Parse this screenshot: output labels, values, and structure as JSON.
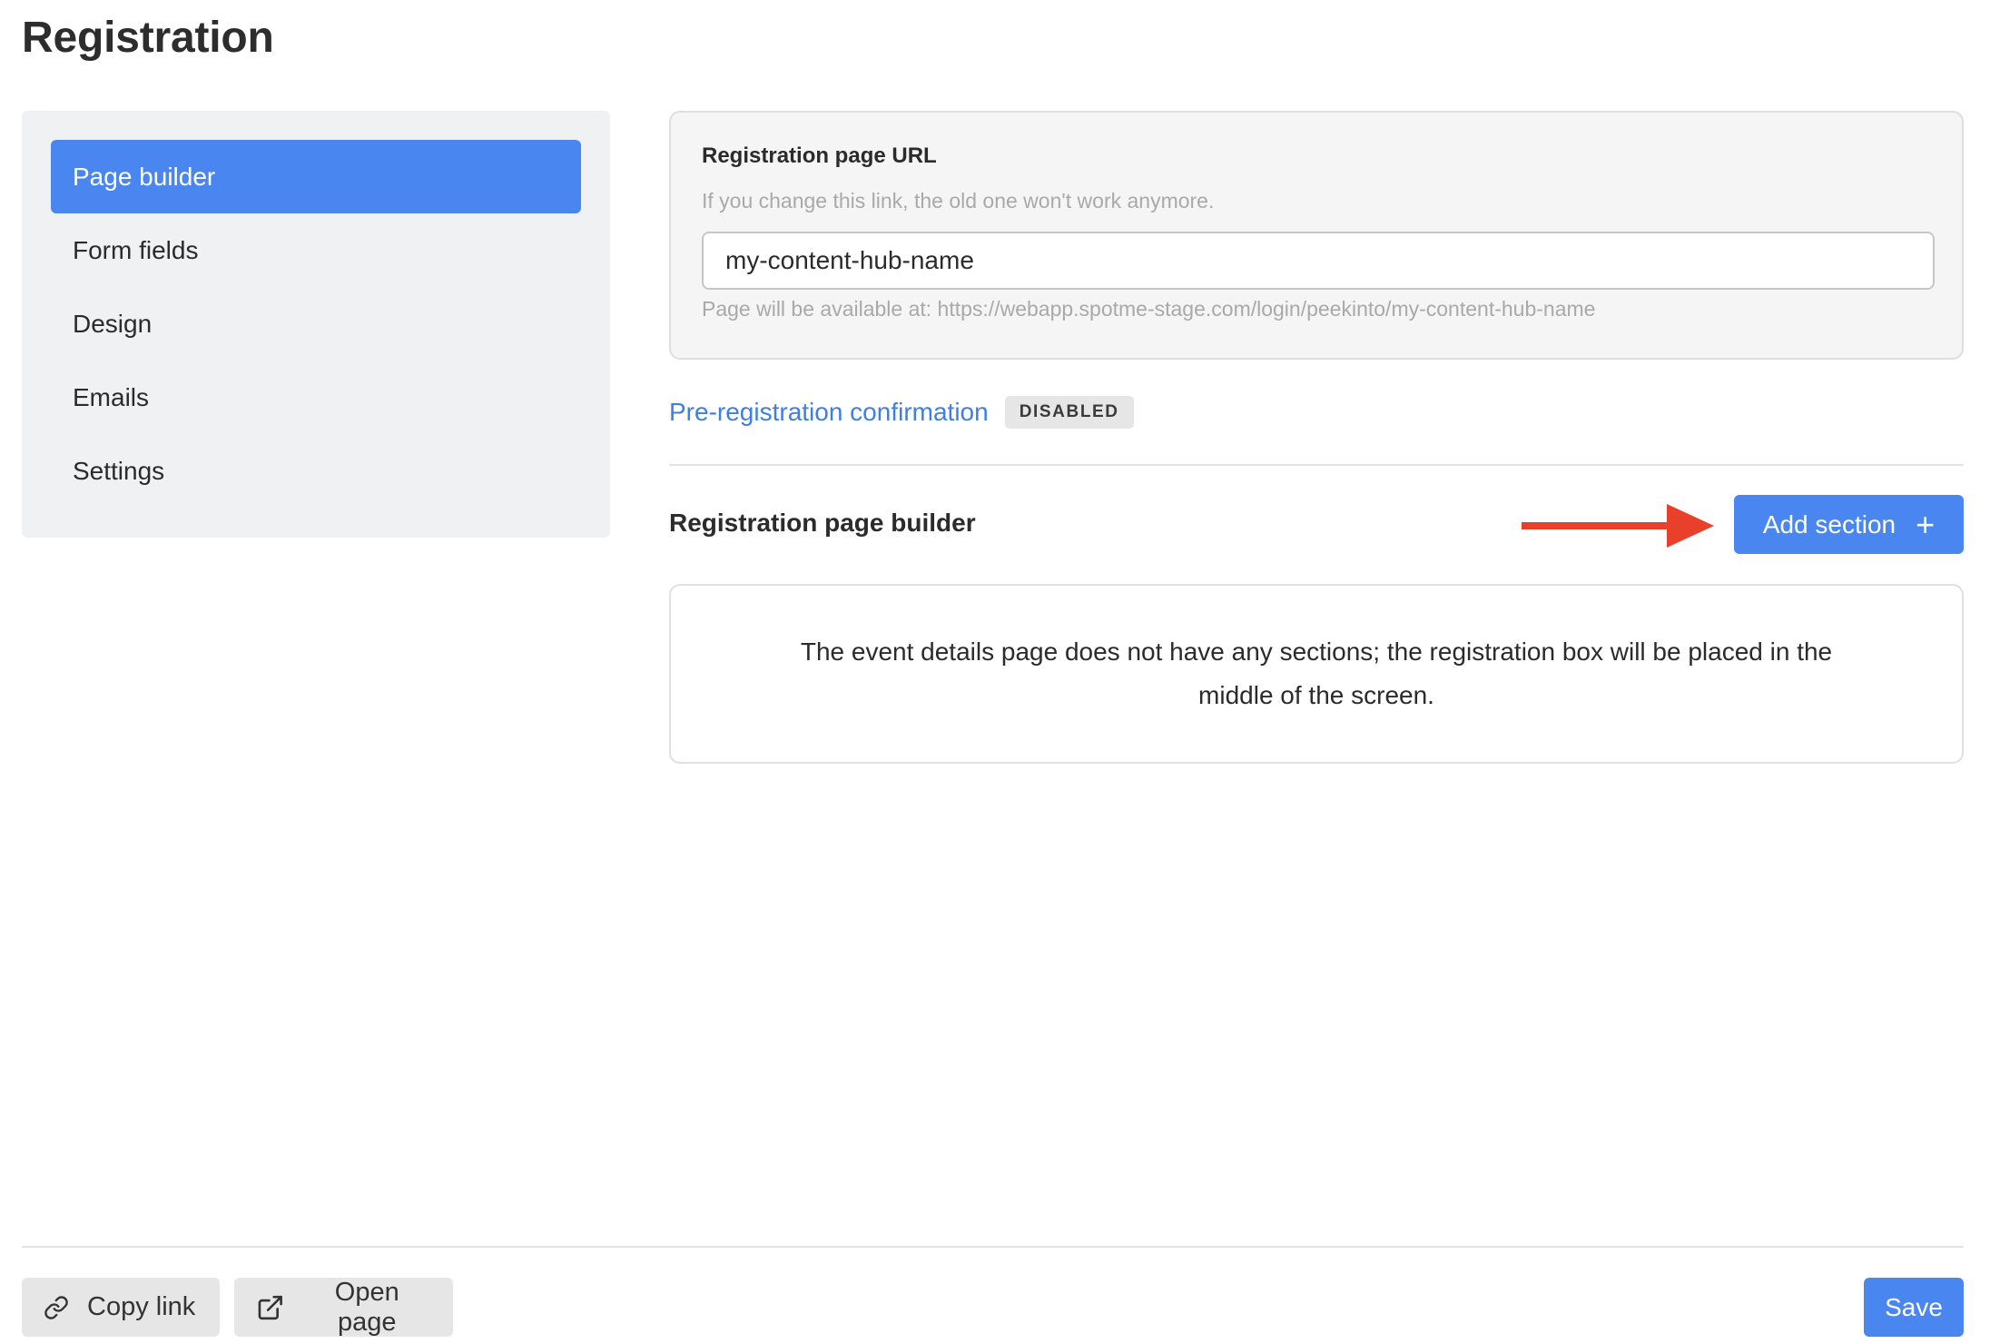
{
  "page": {
    "title": "Registration"
  },
  "sidebar": {
    "items": [
      {
        "label": "Page builder",
        "active": true
      },
      {
        "label": "Form fields",
        "active": false
      },
      {
        "label": "Design",
        "active": false
      },
      {
        "label": "Emails",
        "active": false
      },
      {
        "label": "Settings",
        "active": false
      }
    ]
  },
  "url_card": {
    "label": "Registration page URL",
    "hint": "If you change this link, the old one won't work anymore.",
    "value": "my-content-hub-name",
    "available_text": "Page will be available at: https://webapp.spotme-stage.com/login/peekinto/my-content-hub-name"
  },
  "pre_registration": {
    "link_label": "Pre-registration confirmation",
    "badge": "DISABLED"
  },
  "builder": {
    "title": "Registration page builder",
    "add_button_label": "Add section",
    "add_button_icon": "plus-icon",
    "annotation_arrow_color": "#e8402a",
    "empty_message": "The event details page does not have any sections; the registration box will be placed in the middle of the screen."
  },
  "footer": {
    "copy_link_label": "Copy link",
    "copy_link_icon": "link-icon",
    "open_page_label": "Open page",
    "open_page_icon": "external-link-icon",
    "save_label": "Save"
  },
  "colors": {
    "accent": "#4a86f0",
    "link": "#3d7ee8",
    "annotation": "#e8402a"
  }
}
